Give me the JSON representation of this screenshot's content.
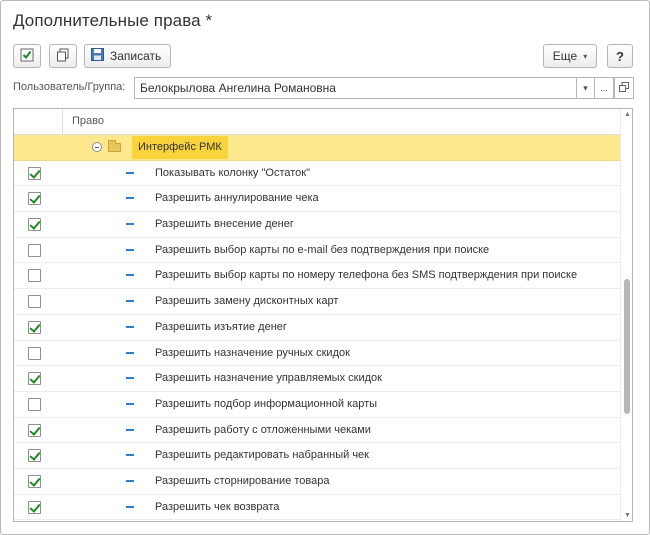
{
  "window": {
    "title": "Дополнительные права *"
  },
  "toolbar": {
    "check_icon": "check-icon",
    "copy_icon": "copy-icon",
    "save_label": "Записать",
    "more_label": "Еще",
    "help_label": "?"
  },
  "user": {
    "label": "Пользователь/Группа:",
    "value": "Белокрылова Ангелина Романовна"
  },
  "table": {
    "column_header": "Право",
    "group": {
      "label": "Интерфейс РМК",
      "expanded": true
    },
    "rows": [
      {
        "label": "Показывать колонку \"Остаток\"",
        "checked": true
      },
      {
        "label": "Разрешить аннулирование чека",
        "checked": true
      },
      {
        "label": "Разрешить внесение денег",
        "checked": true
      },
      {
        "label": "Разрешить выбор карты по e-mail без подтверждения при поиске",
        "checked": false
      },
      {
        "label": "Разрешить выбор карты по номеру телефона без SMS подтверждения при поиске",
        "checked": false
      },
      {
        "label": "Разрешить замену дисконтных карт",
        "checked": false
      },
      {
        "label": "Разрешить изъятие денег",
        "checked": true
      },
      {
        "label": "Разрешить назначение ручных скидок",
        "checked": false
      },
      {
        "label": "Разрешить назначение управляемых скидок",
        "checked": true
      },
      {
        "label": "Разрешить подбор информационной карты",
        "checked": false
      },
      {
        "label": "Разрешить работу с отложенными чеками",
        "checked": true
      },
      {
        "label": "Разрешить редактировать набранный чек",
        "checked": true
      },
      {
        "label": "Разрешить сторнирование товара",
        "checked": true
      },
      {
        "label": "Разрешить чек возврата",
        "checked": true
      }
    ]
  },
  "colors": {
    "group_row": "#fde88e",
    "group_label": "#f8d33b",
    "check": "#1e8a1e",
    "dash": "#2b7fd1"
  }
}
